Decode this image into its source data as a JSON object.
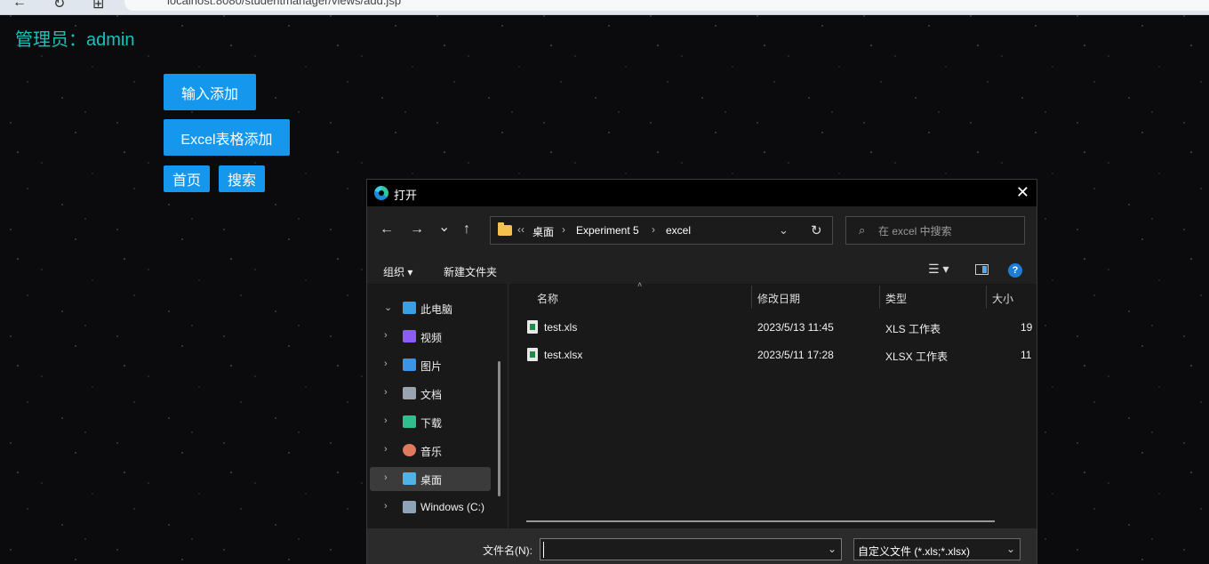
{
  "browser": {
    "back_glyph": "←",
    "reload_glyph": "↻",
    "apps_glyph": "⊞",
    "url": "localhost:8080/studentmanager/views/add.jsp"
  },
  "page": {
    "admin_label": "管理员：admin",
    "buttons": {
      "input_add": "输入添加",
      "excel_add": "Excel表格添加",
      "home": "首页",
      "search": "搜索"
    }
  },
  "dialog": {
    "title": "打开",
    "close_glyph": "✕",
    "nav": {
      "back": "←",
      "forward": "→",
      "recent": "⌄",
      "up": "↑"
    },
    "address": {
      "overflow": "‹‹",
      "crumbs": [
        "桌面",
        "Experiment 5",
        "excel"
      ],
      "sep": "›",
      "dropdown_glyph": "⌄",
      "refresh_glyph": "↻"
    },
    "search": {
      "icon": "search-icon",
      "placeholder": "在 excel 中搜索"
    },
    "commands": {
      "organize": "组织 ▾",
      "new_folder": "新建文件夹",
      "view_glyph": "☰ ▾",
      "help_glyph": "?"
    },
    "sidebar": [
      {
        "label": "此电脑",
        "icon": "computer-icon",
        "color": "#3aa0e6",
        "chev": "⌄",
        "selected": false
      },
      {
        "label": "视频",
        "icon": "video-icon",
        "color": "#8b5cf6",
        "chev": "›",
        "selected": false
      },
      {
        "label": "图片",
        "icon": "pictures-icon",
        "color": "#3b95e6",
        "chev": "›",
        "selected": false
      },
      {
        "label": "文档",
        "icon": "documents-icon",
        "color": "#9aa4b0",
        "chev": "›",
        "selected": false
      },
      {
        "label": "下载",
        "icon": "downloads-icon",
        "color": "#2fbf8f",
        "chev": "›",
        "selected": false
      },
      {
        "label": "音乐",
        "icon": "music-icon",
        "color": "#e07a5f",
        "chev": "›",
        "selected": false
      },
      {
        "label": "桌面",
        "icon": "desktop-icon",
        "color": "#4fb3e8",
        "chev": "›",
        "selected": true
      },
      {
        "label": "Windows (C:)",
        "icon": "drive-icon",
        "color": "#8fa3b8",
        "chev": "›",
        "selected": false
      }
    ],
    "columns": {
      "name": "名称",
      "modified": "修改日期",
      "type": "类型",
      "size": "大小"
    },
    "files": [
      {
        "name": "test.xls",
        "modified": "2023/5/13 11:45",
        "type": "XLS 工作表",
        "size": "19"
      },
      {
        "name": "test.xlsx",
        "modified": "2023/5/11 17:28",
        "type": "XLSX 工作表",
        "size": "11"
      }
    ],
    "footer": {
      "filename_label": "文件名(N):",
      "filename_value": "",
      "filetype": "自定义文件 (*.xls;*.xlsx)",
      "chev": "⌄"
    }
  }
}
